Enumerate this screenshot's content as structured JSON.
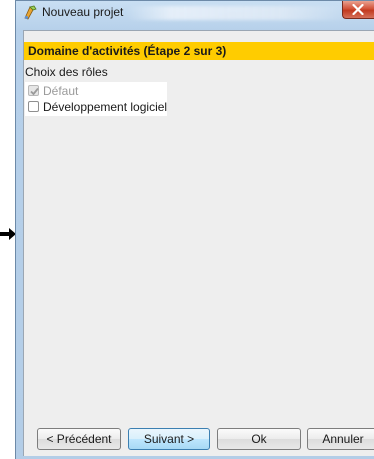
{
  "window": {
    "title": "Nouveau projet",
    "close_label": "close"
  },
  "wizard": {
    "step_header": "Domaine d'activités (Étape 2 sur 3)",
    "roles_label": "Choix des rôles",
    "roles": [
      {
        "label": "Défaut",
        "checked": true,
        "enabled": false
      },
      {
        "label": "Développement logiciel",
        "checked": false,
        "enabled": true
      }
    ]
  },
  "buttons": {
    "previous": "< Précédent",
    "next": "Suivant >",
    "ok": "Ok",
    "cancel": "Annuler"
  },
  "colors": {
    "header_background": "#ffcc00",
    "client_background": "#eeeeee",
    "frame_background": "#b6d0ea"
  }
}
